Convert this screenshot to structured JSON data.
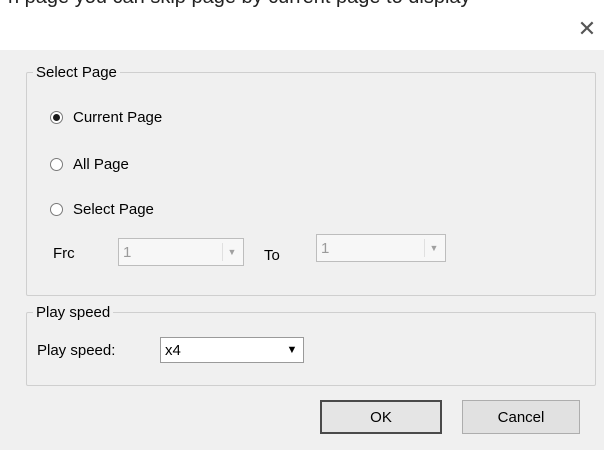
{
  "window": {
    "top_caption": "n page you can skip page by current page to display",
    "close_glyph": "✕"
  },
  "select_page": {
    "legend": "Select Page",
    "options": [
      {
        "label": "Current Page",
        "checked": true
      },
      {
        "label": "All Page",
        "checked": false
      },
      {
        "label": "Select Page",
        "checked": false
      }
    ],
    "from_label": "Frc",
    "from_value": "1",
    "to_label": "To",
    "to_value": "1"
  },
  "play_speed": {
    "legend": "Play speed",
    "label": "Play speed:",
    "value": "x4"
  },
  "buttons": {
    "ok": "OK",
    "cancel": "Cancel"
  },
  "icons": {
    "close": "close-icon",
    "dropdown": "chevron-down-icon"
  }
}
